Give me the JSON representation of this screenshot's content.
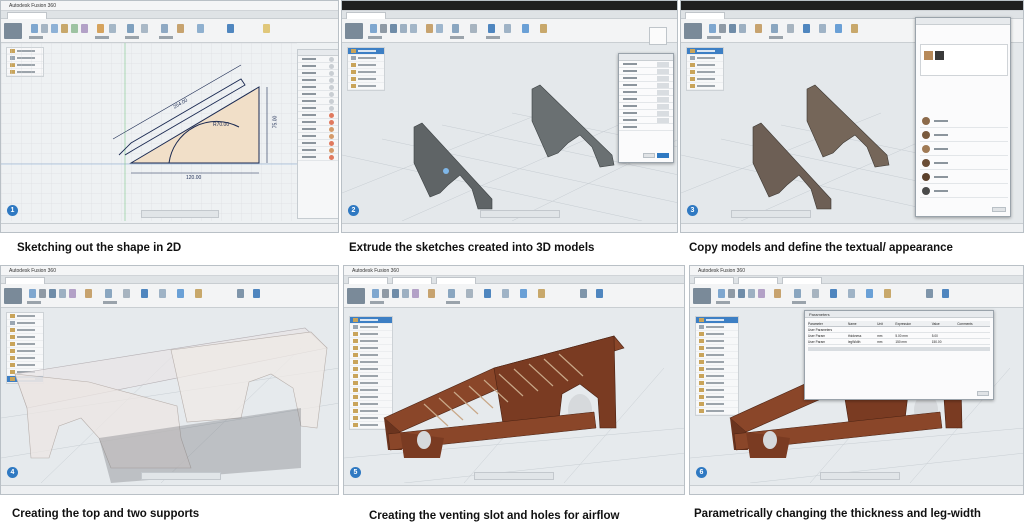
{
  "panels": [
    {
      "step": "1",
      "caption": "Sketching out the shape in 2D",
      "title": "Autodesk Fusion 360"
    },
    {
      "step": "2",
      "caption": "Extrude the sketches created into 3D models",
      "title": ""
    },
    {
      "step": "3",
      "caption": "Copy models and define the textual/ appearance",
      "title": ""
    },
    {
      "step": "4",
      "caption": "Creating the top and two supports",
      "title": "Autodesk Fusion 360"
    },
    {
      "step": "5",
      "caption": "Creating the venting slot and holes for airflow",
      "title": "Autodesk Fusion 360"
    },
    {
      "step": "6",
      "caption": "Parametrically changing the thickness and leg-width",
      "title": "Autodesk Fusion 360"
    }
  ],
  "sketch_dims": {
    "a": "254.00",
    "b": "75.00",
    "c": "R70.00",
    "d": "120.00"
  },
  "parameters_dialog": {
    "title": "Parameters",
    "headers": [
      "Parameter",
      "Name",
      "Unit",
      "Expression",
      "Value",
      "Comments"
    ],
    "rows": [
      [
        "User Parameters",
        "",
        "",
        "",
        "",
        ""
      ],
      [
        "User Param",
        "thickness",
        "mm",
        "5.00 mm",
        "5.00",
        ""
      ],
      [
        "User Param",
        "legWidth",
        "mm",
        "150 mm",
        "150.00",
        ""
      ]
    ]
  },
  "colors": {
    "accent": "#2f79c2",
    "wood": "#7a3b22",
    "grey_model": "#5f6466",
    "sketch_fill": "#f1dfc8",
    "grid": "#c9cfd4"
  }
}
